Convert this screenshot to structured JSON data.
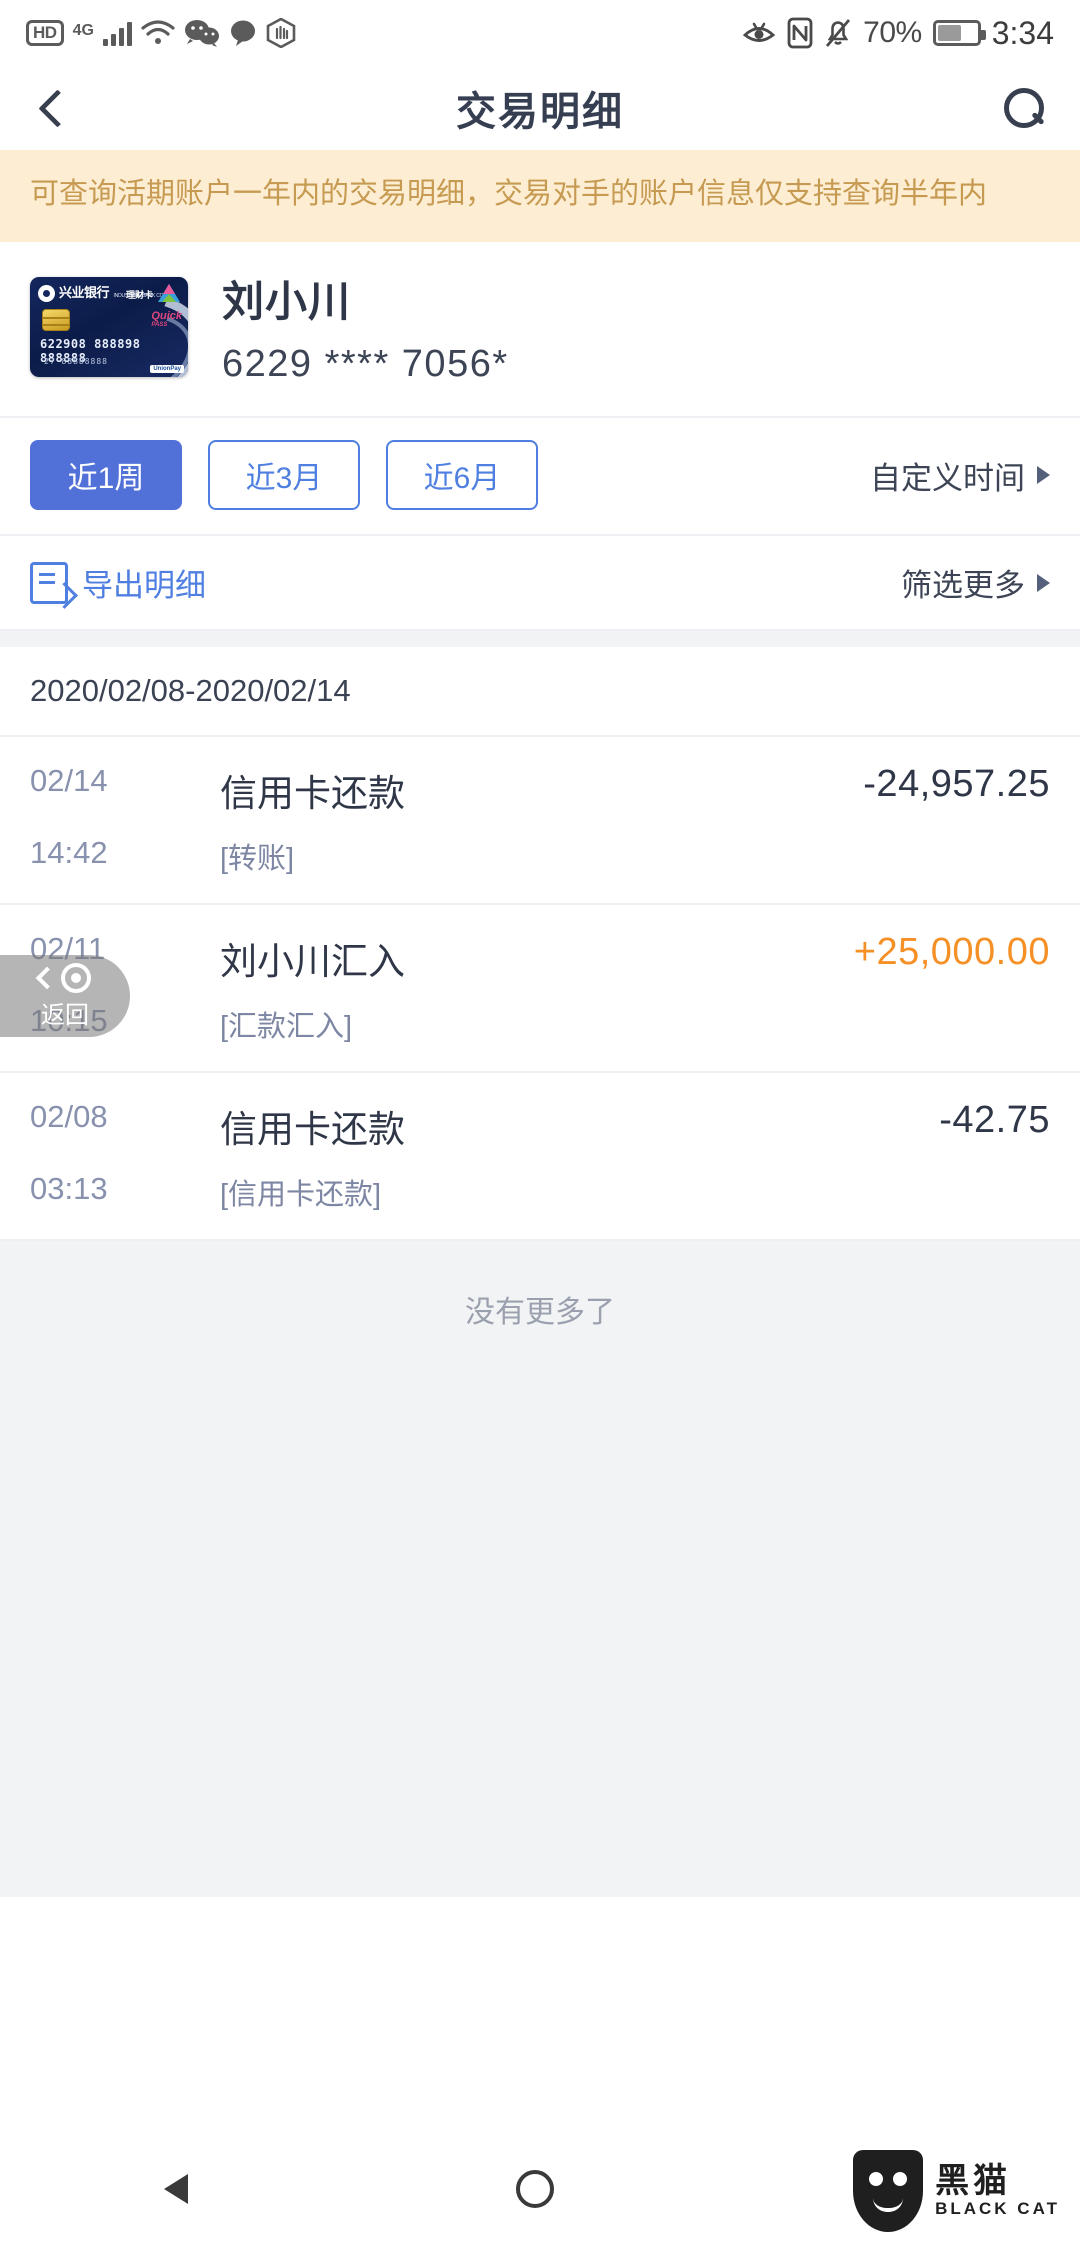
{
  "statusbar": {
    "hd_label": "HD",
    "network_label": "4G",
    "icons_left": [
      "hd-icon",
      "4g-signal-icon",
      "wifi-icon",
      "wechat-icon",
      "message-icon",
      "hand-gesture-icon"
    ],
    "icons_right": [
      "eye-comfort-icon",
      "nfc-icon",
      "mute-bell-icon",
      "battery-icon"
    ],
    "battery_pct": "70%",
    "time": "3:34"
  },
  "appbar": {
    "title": "交易明细",
    "back_icon": "back-chevron-icon",
    "search_icon": "search-icon"
  },
  "notice": {
    "text": "可查询活期账户一年内的交易明细，交易对手的账户信息仅支持查询半年内",
    "bg_color": "#fdeed3",
    "text_color": "#c79a52"
  },
  "account": {
    "holder_name": "刘小川",
    "card_number": "6229 **** 7056*",
    "card": {
      "bank_name": "兴业银行",
      "bank_name_en": "INDUSTRIAL BANK CO.,LTD",
      "card_type": "理财卡",
      "number_front": "622908  888898  888888",
      "number_small": "27  88888888",
      "quickpass": "Quick",
      "quickpass_sub": "PASS",
      "network": "UnionPay"
    }
  },
  "filters": {
    "chips": [
      {
        "label": "近1周",
        "active": true
      },
      {
        "label": "近3月",
        "active": false
      },
      {
        "label": "近6月",
        "active": false
      }
    ],
    "custom_time_label": "自定义时间",
    "custom_time_icon": "caret-right-icon"
  },
  "actions": {
    "export_label": "导出明细",
    "export_icon": "export-document-icon",
    "filter_more_label": "筛选更多",
    "filter_more_icon": "caret-right-icon"
  },
  "list": {
    "date_range": "2020/02/08-2020/02/14",
    "transactions": [
      {
        "date": "02/14",
        "time": "14:42",
        "title": "信用卡还款",
        "tag": "[转账]",
        "amount": "-24,957.25",
        "kind": "debit"
      },
      {
        "date": "02/11",
        "time": "10:15",
        "title": "刘小川汇入",
        "tag": "[汇款汇入]",
        "amount": "+25,000.00",
        "kind": "credit"
      },
      {
        "date": "02/08",
        "time": "03:13",
        "title": "信用卡还款",
        "tag": "[信用卡还款]",
        "amount": "-42.75",
        "kind": "debit"
      }
    ],
    "no_more_label": "没有更多了"
  },
  "float_back": {
    "label": "返回",
    "icon": "weibo-spiral-icon"
  },
  "navbar": {
    "back_icon": "nav-back-triangle-icon",
    "home_icon": "nav-home-circle-icon",
    "recents_icon": "nav-recents-square-icon"
  },
  "watermark": {
    "cn": "黑猫",
    "en": "BLACK CAT",
    "icon": "black-cat-shield-icon"
  },
  "colors": {
    "accent_blue": "#5271d8",
    "link_blue": "#4f7fe0",
    "credit_orange": "#f59026",
    "text_dark": "#2f3647",
    "text_muted": "#8891ad"
  }
}
